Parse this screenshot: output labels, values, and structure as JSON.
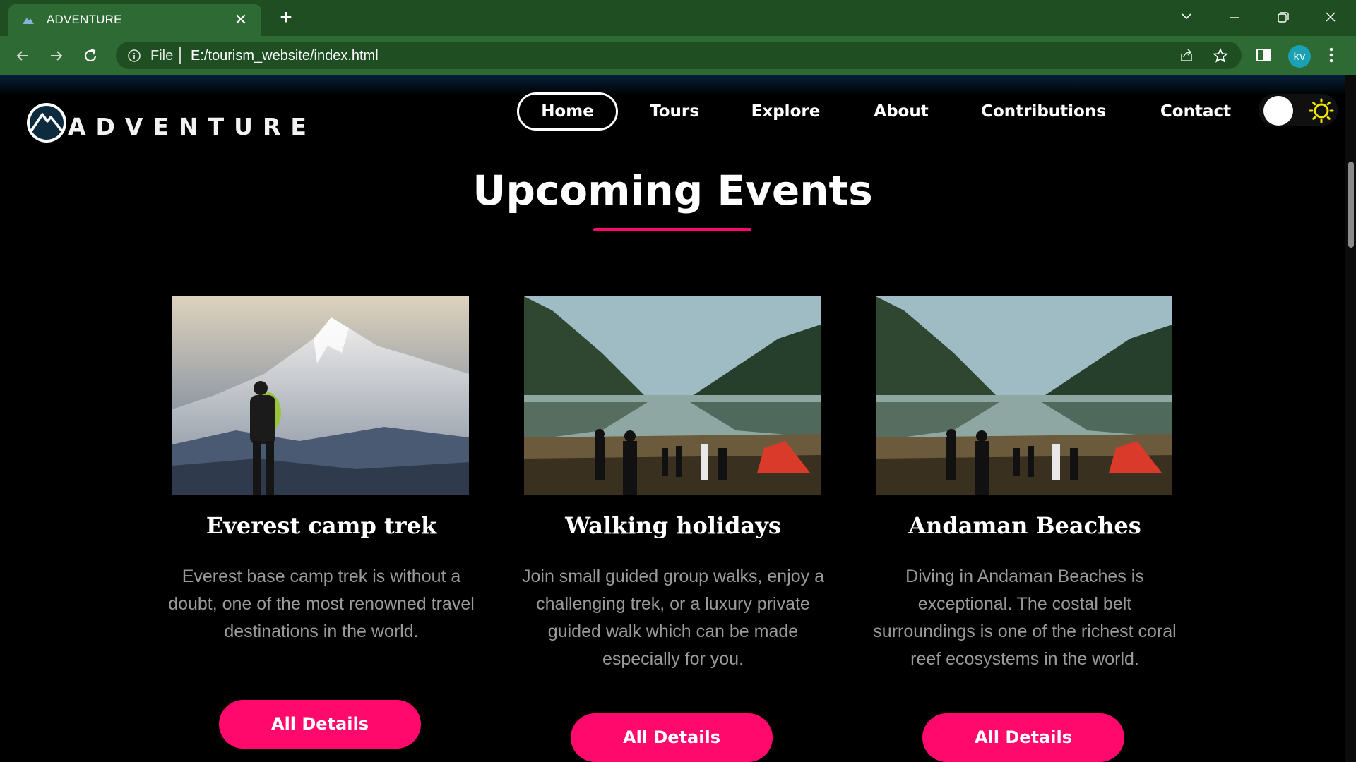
{
  "browser": {
    "tab_title": "ADVENTURE",
    "url_scheme": "File",
    "url": "E:/tourism_website/index.html",
    "profile_initials": "kv"
  },
  "site": {
    "logo_text": "ADVENTURE",
    "nav": [
      {
        "label": "Home",
        "active": true
      },
      {
        "label": "Tours",
        "active": false
      },
      {
        "label": "Explore",
        "active": false
      },
      {
        "label": "About",
        "active": false
      },
      {
        "label": "Contributions",
        "active": false
      },
      {
        "label": "Contact",
        "active": false
      }
    ],
    "theme": "dark"
  },
  "events": {
    "title": "Upcoming Events",
    "accent_color": "#ff0a6c",
    "cards": [
      {
        "title": "Everest camp trek",
        "description": "Everest base camp trek is without a doubt, one of the most renowned travel destinations in the world.",
        "button": "All Details",
        "image": "mountain-hiker"
      },
      {
        "title": "Walking holidays",
        "description": "Join small guided group walks, enjoy a challenging trek, or a luxury private guided walk which can be made especially for you.",
        "button": "All Details",
        "image": "lake-camp"
      },
      {
        "title": "Andaman Beaches",
        "description": "Diving in Andaman Beaches is exceptional. The costal belt surroundings is one of the richest coral reef ecosystems in the world.",
        "button": "All Details",
        "image": "lake-camp"
      }
    ]
  }
}
